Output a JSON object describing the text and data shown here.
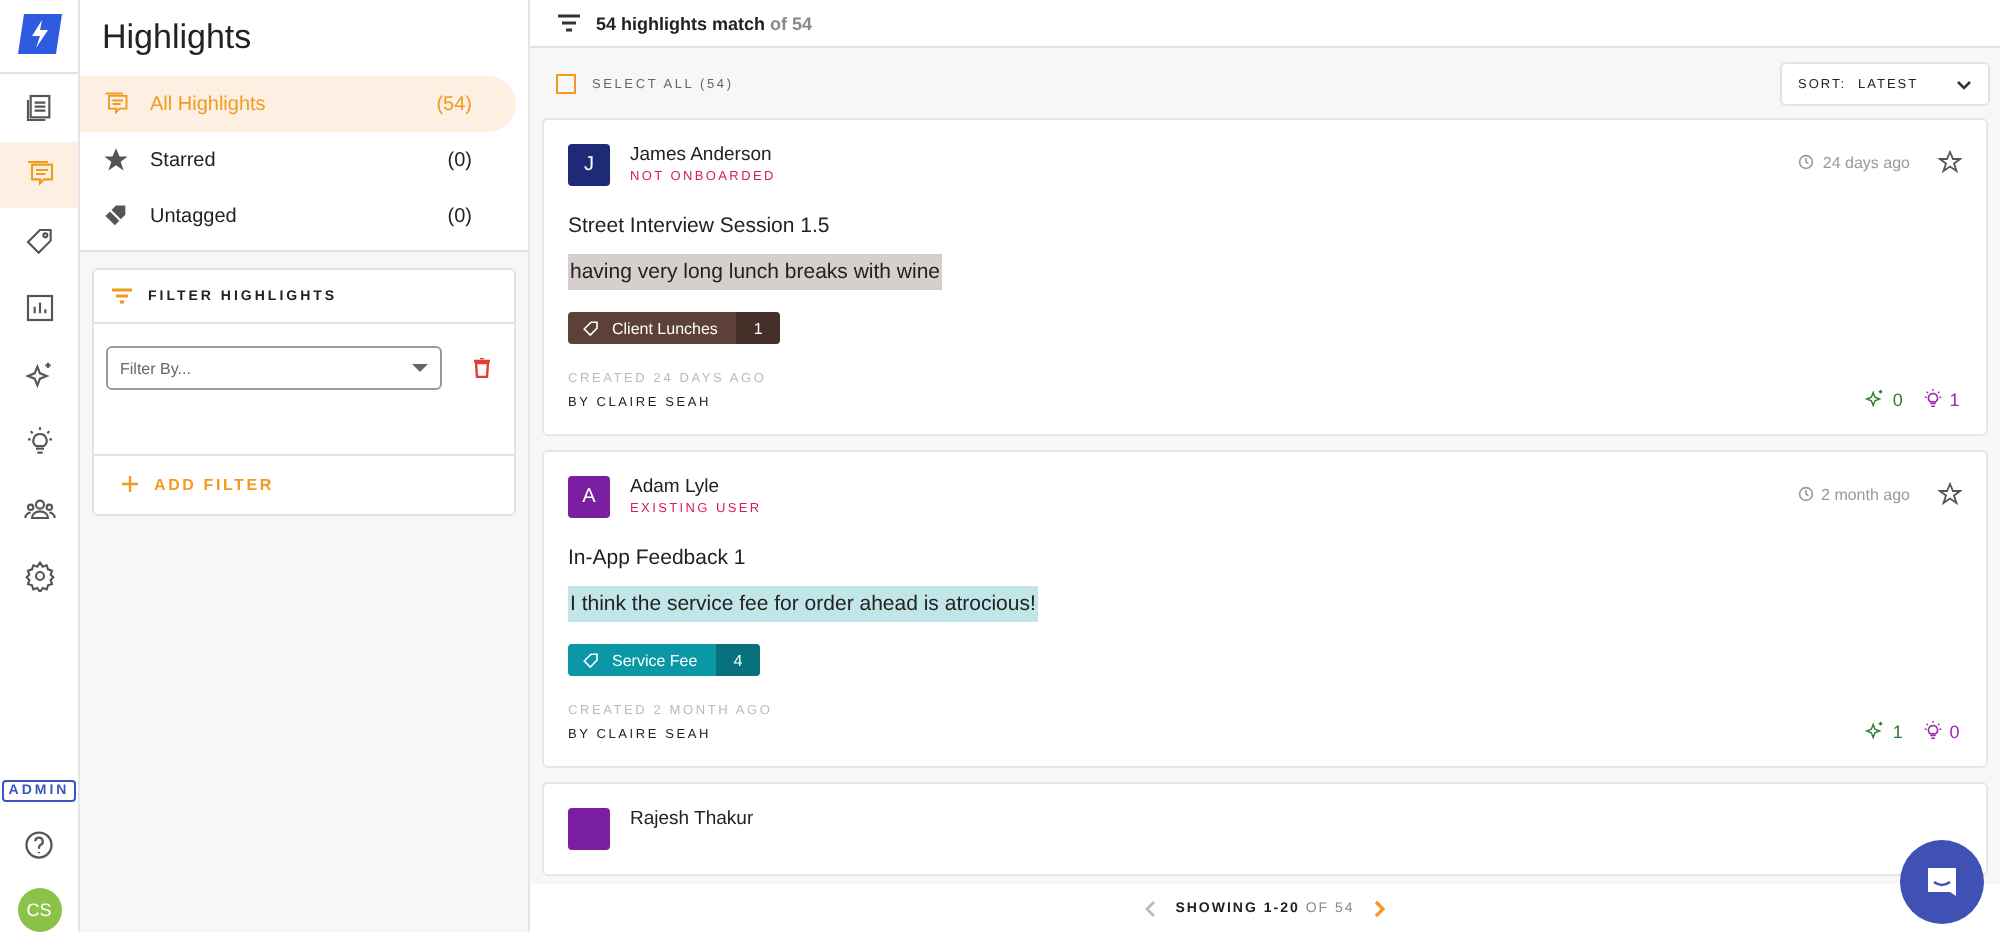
{
  "rail": {
    "items": [
      {
        "kind": "document",
        "selected": false
      },
      {
        "kind": "highlights",
        "selected": true
      },
      {
        "kind": "tag",
        "selected": false
      },
      {
        "kind": "chart",
        "selected": false
      },
      {
        "kind": "sparkle",
        "selected": false
      },
      {
        "kind": "bulb",
        "selected": false
      },
      {
        "kind": "people",
        "selected": false
      },
      {
        "kind": "gear",
        "selected": false
      }
    ],
    "badge": "ADMIN",
    "user_initials": "CS"
  },
  "sidebar": {
    "title": "Highlights",
    "items": [
      {
        "kind": "highlights",
        "label": "All Highlights",
        "count": "(54)",
        "selected": true
      },
      {
        "kind": "star",
        "label": "Starred",
        "count": "(0)",
        "selected": false
      },
      {
        "kind": "untag",
        "label": "Untagged",
        "count": "(0)",
        "selected": false
      }
    ],
    "filter": {
      "title": "FILTER HIGHLIGHTS",
      "select_placeholder": "Filter By...",
      "add_label": "ADD FILTER"
    }
  },
  "header": {
    "match": "54 highlights match",
    "of": "of 54"
  },
  "toolbar": {
    "select_all": "SELECT ALL (54)",
    "checked": false,
    "sort_label": "SORT:",
    "sort_value": "LATEST"
  },
  "cards": [
    {
      "avatar": {
        "letter": "J",
        "color": "#1e2a78"
      },
      "name": "James Anderson",
      "status": "NOT ONBOARDED",
      "time": "24 days ago",
      "title": "Street Interview Session 1.5",
      "quote": "having very long lunch breaks with wine",
      "tags": [
        {
          "label": "Client Lunches",
          "count": "1",
          "color": "#5d4037"
        }
      ],
      "created": "CREATED 24 DAYS AGO",
      "author": "BY CLAIRE SEAH",
      "insights": "0",
      "ideas": "1"
    },
    {
      "avatar": {
        "letter": "A",
        "color": "#7b1fa2"
      },
      "name": "Adam Lyle",
      "status": "EXISTING USER",
      "time": "2 month ago",
      "title": "In-App Feedback 1",
      "quote": "I think the service fee for order ahead is atrocious!",
      "tags": [
        {
          "label": "Service Fee",
          "count": "4",
          "color": "#0a97a6"
        }
      ],
      "created": "CREATED 2 MONTH AGO",
      "author": "BY CLAIRE SEAH",
      "insights": "1",
      "ideas": "0"
    },
    {
      "avatar": {
        "color": "#7b1fa2"
      },
      "name": "Rajesh Thakur"
    }
  ],
  "pagination": {
    "showing": "SHOWING 1-20",
    "of": "OF 54"
  }
}
